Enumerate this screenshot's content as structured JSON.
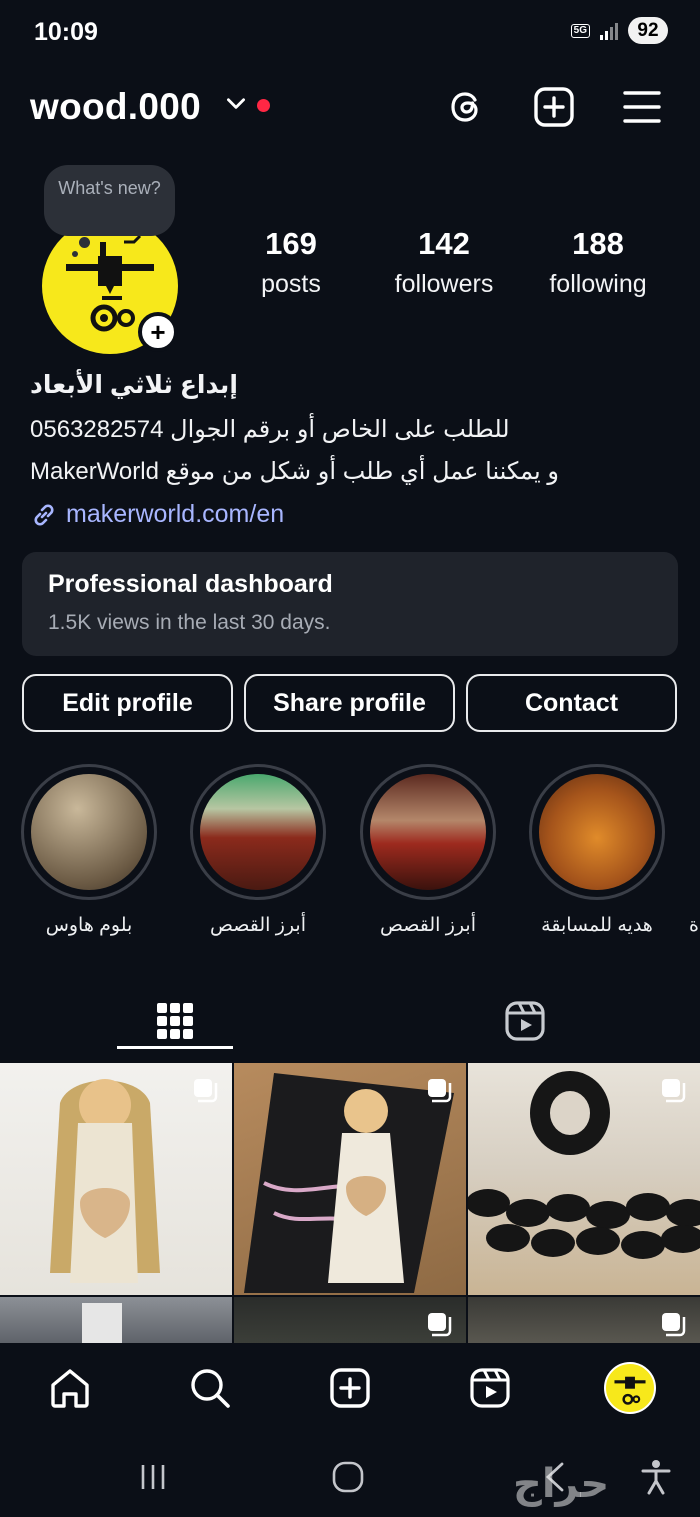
{
  "status_bar": {
    "time": "10:09",
    "network": "5G",
    "battery": "92"
  },
  "header": {
    "username": "wood.000"
  },
  "profile": {
    "note": "What's new?",
    "stats": [
      {
        "value": "169",
        "label": "posts"
      },
      {
        "value": "142",
        "label": "followers"
      },
      {
        "value": "188",
        "label": "following"
      }
    ],
    "bio_name": "إبداع ثلاثي الأبعاد",
    "bio_lines": [
      "للطلب على الخاص أو برقم الجوال  0563282574",
      "و يمكننا عمل أي طلب أو شكل من موقع MakerWorld"
    ],
    "link": "makerworld.com/en"
  },
  "dashboard": {
    "title": "Professional dashboard",
    "subtitle": "1.5K views in the last 30 days."
  },
  "actions": {
    "edit": "Edit profile",
    "share": "Share profile",
    "contact": "Contact"
  },
  "highlights": [
    {
      "label": "بلوم هاوس"
    },
    {
      "label": "أبرز القصص"
    },
    {
      "label": "أبرز القصص"
    },
    {
      "label": "هديه للمسابقة"
    },
    {
      "label": "ة"
    }
  ],
  "tabs": [
    {
      "icon": "grid-icon"
    },
    {
      "icon": "reels-icon"
    }
  ],
  "bottom_nav": [
    {
      "icon": "home-icon"
    },
    {
      "icon": "search-icon"
    },
    {
      "icon": "create-icon"
    },
    {
      "icon": "reels-icon"
    },
    {
      "icon": "profile-avatar"
    }
  ],
  "watermark": "حراج",
  "colors": {
    "accent_link": "#a8b6ff",
    "live_dot": "#ff2744",
    "avatar_bg": "#f7e81b",
    "background": "#0b0f17"
  }
}
